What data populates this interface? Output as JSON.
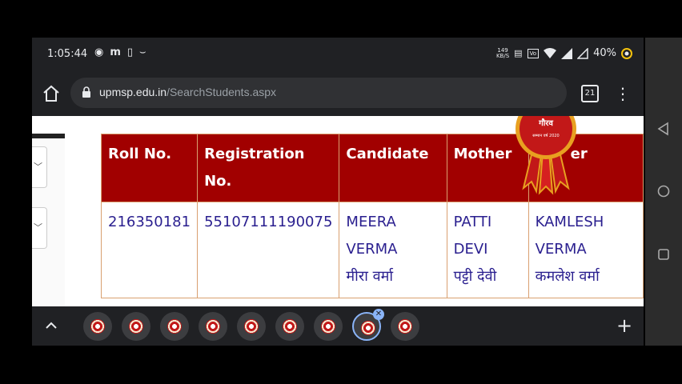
{
  "status_bar": {
    "time": "1:05:44",
    "net_speed_value": "149",
    "net_speed_unit": "KB/S",
    "volte_top": "Vo",
    "volte_bottom": "WiFi",
    "battery": "40%"
  },
  "browser": {
    "url_domain": "upmsp.edu.in",
    "url_path": "/SearchStudents.aspx",
    "tab_count": "21"
  },
  "table": {
    "headers": {
      "roll": "Roll No.",
      "reg_line1": "Registration",
      "reg_line2": "No.",
      "candidate": "Candidate",
      "mother": "Mother",
      "father_partial": "er"
    },
    "row": {
      "roll": "216350181",
      "registration": "55107111190075",
      "candidate_l1": "MEERA",
      "candidate_l2": "VERMA",
      "candidate_hindi": "मीरा वर्मा",
      "mother_l1": "PATTI",
      "mother_l2": "DEVI",
      "mother_hindi": "पट्टी देवी",
      "father_l1": "KAMLESH",
      "father_l2": "VERMA",
      "father_hindi": "कमलेश वर्मा"
    }
  },
  "seal": {
    "text": "गौरव",
    "subtext": "सम्मान वर्ष 2020"
  },
  "colors": {
    "header_bg": "#a10000",
    "cell_text": "#2a1f8f",
    "cell_border": "#d9a070"
  },
  "icons": {
    "home": "home-icon",
    "lock": "lock-icon",
    "menu": "more-vert-icon",
    "chevron_up": "chevron-up-icon",
    "plus": "plus-icon",
    "back": "back-triangle-icon",
    "home_nav": "home-circle-icon",
    "recents": "recents-square-icon"
  }
}
